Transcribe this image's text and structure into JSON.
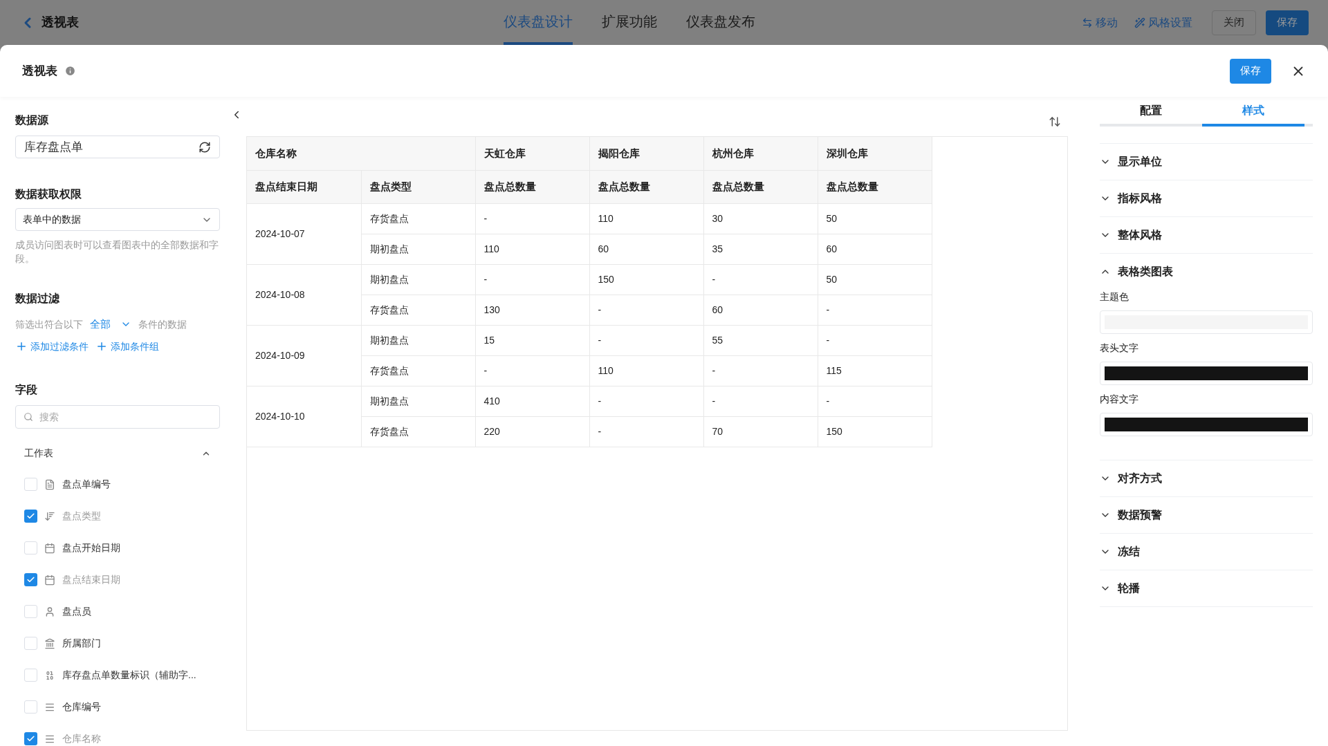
{
  "top_bar": {
    "title": "透视表",
    "tabs": [
      {
        "label": "仪表盘设计",
        "selected": true
      },
      {
        "label": "扩展功能",
        "selected": false
      },
      {
        "label": "仪表盘发布",
        "selected": false
      }
    ],
    "actions": [
      {
        "label": "移动",
        "kind": "move"
      },
      {
        "label": "风格设置",
        "kind": "style"
      }
    ],
    "buttons": [
      {
        "label": "关闭",
        "kind": "outline"
      },
      {
        "label": "保存",
        "kind": "primary"
      }
    ]
  },
  "dialog": {
    "title": "透视表",
    "save_label": "保存"
  },
  "left_panel": {
    "data_source": {
      "label": "数据源",
      "value": "库存盘点单"
    },
    "permission": {
      "label": "数据获取权限",
      "value": "表单中的数据",
      "hint": "成员访问图表时可以查看图表中的全部数据和字段。"
    },
    "filter": {
      "label": "数据过滤",
      "prefix": "筛选出符合以下",
      "mode": "全部",
      "suffix": "条件的数据",
      "links": [
        "添加过滤条件",
        "添加条件组"
      ]
    },
    "fields": {
      "label": "字段",
      "placeholder": "搜索",
      "group": {
        "label": "工作表",
        "expanded": true
      },
      "items": [
        {
          "label": "盘点单编号",
          "kind": "text",
          "checked": false
        },
        {
          "label": "盘点类型",
          "kind": "sort",
          "checked": true
        },
        {
          "label": "盘点开始日期",
          "kind": "date",
          "checked": false
        },
        {
          "label": "盘点结束日期",
          "kind": "date",
          "checked": true
        },
        {
          "label": "盘点员",
          "kind": "person",
          "checked": false
        },
        {
          "label": "所属部门",
          "kind": "department",
          "checked": false
        },
        {
          "label": "库存盘点单数量标识（辅助字...",
          "kind": "number",
          "checked": false
        },
        {
          "label": "仓库编号",
          "kind": "lines",
          "checked": false
        },
        {
          "label": "仓库名称",
          "kind": "lines",
          "checked": true
        }
      ]
    }
  },
  "table": {
    "column_header": "仓库名称",
    "warehouses": [
      "天虹仓库",
      "揭阳仓库",
      "杭州仓库",
      "深圳仓库"
    ],
    "row_headers": [
      "盘点结束日期",
      "盘点类型"
    ],
    "measures": [
      "盘点总数量",
      "盘点总数量",
      "盘点总数量",
      "盘点总数量"
    ],
    "groups": [
      {
        "date": "2024-10-07",
        "rows": [
          {
            "type": "存货盘点",
            "values": [
              "-",
              "110",
              "30",
              "50"
            ]
          },
          {
            "type": "期初盘点",
            "values": [
              "110",
              "60",
              "35",
              "60"
            ]
          }
        ]
      },
      {
        "date": "2024-10-08",
        "rows": [
          {
            "type": "期初盘点",
            "values": [
              "-",
              "150",
              "-",
              "50"
            ]
          },
          {
            "type": "存货盘点",
            "values": [
              "130",
              "-",
              "60",
              "-"
            ]
          }
        ]
      },
      {
        "date": "2024-10-09",
        "rows": [
          {
            "type": "期初盘点",
            "values": [
              "15",
              "-",
              "55",
              "-"
            ]
          },
          {
            "type": "存货盘点",
            "values": [
              "-",
              "110",
              "-",
              "115"
            ]
          }
        ]
      },
      {
        "date": "2024-10-10",
        "rows": [
          {
            "type": "期初盘点",
            "values": [
              "410",
              "-",
              "-",
              "-"
            ]
          },
          {
            "type": "存货盘点",
            "values": [
              "220",
              "-",
              "70",
              "150"
            ]
          }
        ]
      }
    ]
  },
  "right_panel": {
    "tabs": [
      {
        "label": "配置",
        "selected": false
      },
      {
        "label": "样式",
        "selected": true
      }
    ],
    "sections": [
      {
        "label": "显示单位",
        "expanded": false
      },
      {
        "label": "指标风格",
        "expanded": false
      },
      {
        "label": "整体风格",
        "expanded": false
      },
      {
        "label": "表格类图表",
        "expanded": true,
        "colors": [
          {
            "label": "主题色",
            "color": "#f5f5f5"
          },
          {
            "label": "表头文字",
            "color": "#141414"
          },
          {
            "label": "内容文字",
            "color": "#141414"
          }
        ]
      },
      {
        "label": "对齐方式",
        "expanded": false
      },
      {
        "label": "数据预警",
        "expanded": false
      },
      {
        "label": "冻结",
        "expanded": false
      },
      {
        "label": "轮播",
        "expanded": false
      }
    ]
  }
}
